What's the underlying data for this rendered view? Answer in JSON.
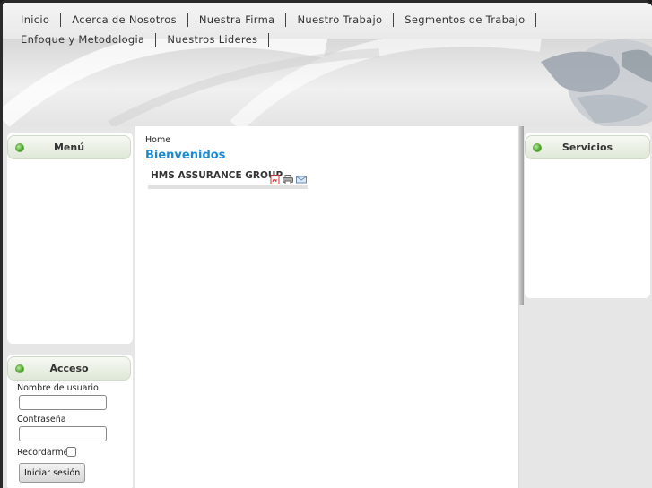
{
  "nav": {
    "items": [
      "Inicio",
      "Acerca de Nosotros",
      "Nuestra Firma",
      "Nuestro Trabajo",
      "Segmentos de Trabajo",
      "Enfoque y Metodologia",
      "Nuestros Lideres"
    ]
  },
  "left": {
    "menu_title": "Menú",
    "login_title": "Acceso",
    "username_label": "Nombre de usuario",
    "username_value": "",
    "password_label": "Contraseña",
    "password_value": "",
    "remember_label": "Recordarme",
    "login_button": "Iniciar sesión"
  },
  "right": {
    "services_title": "Servicios"
  },
  "main": {
    "breadcrumb": "Home",
    "title": "Bienvenidos",
    "article_title": "HMS ASSURANCE GROUP",
    "icons": [
      "pdf-icon",
      "print-icon",
      "email-icon"
    ]
  },
  "colors": {
    "title_blue": "#1a8ad0",
    "box_header_green": "#dfe8d8",
    "status_dot": "#3c9a1c"
  }
}
